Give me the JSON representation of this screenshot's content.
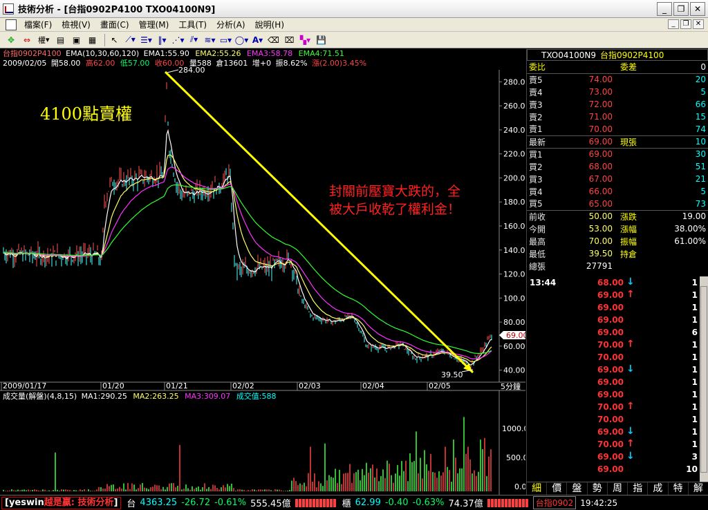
{
  "window": {
    "title": "技術分析 - [台指0902P4100 TXO04100N9]"
  },
  "menu": [
    "檔案(F)",
    "檢視(V)",
    "畫面(C)",
    "管理(M)",
    "工具(T)",
    "分析(A)",
    "說明(H)"
  ],
  "toolbar": {
    "period_label": "權"
  },
  "chart": {
    "info1": {
      "symbol": "台指0902P4100",
      "ema_head": "EMA(10,30,60,120)",
      "ema1": "EMA1:55.90",
      "ema2": "EMA2:55.26",
      "ema3": "EMA3:58.78",
      "ema4": "EMA4:71.51"
    },
    "info2": {
      "date": "2009/02/05",
      "open": "開58.00",
      "high": "高62.00",
      "low": "低57.00",
      "close": "收60.00",
      "vol": "量588",
      "oi": "倉13601",
      "oichg": "增+0",
      "amp": "振8.62%",
      "chg": "漲(2.00)3.45%"
    },
    "headline": "4100點賣權",
    "annotation_line1": "封關前壓寶大跌的，全",
    "annotation_line2": "被大戶收乾了權利金！",
    "peak_label": "284.00",
    "low_label": "39.50",
    "last_price": "69.00",
    "period": "5分鐘",
    "dates": [
      "2009/01/17",
      "01/20",
      "01/21",
      "02/02",
      "02/03",
      "02/04",
      "02/05"
    ],
    "vol_info": {
      "name": "成交量(解盤)(4,8,15)",
      "ma1": "MA1:290.25",
      "ma2": "MA2:263.25",
      "ma3": "MA3:309.07",
      "cur": "成交值:588"
    },
    "vol_ticks": [
      "1000.0",
      "500.0",
      "0.0"
    ]
  },
  "chart_data": {
    "type": "line",
    "title": "台指0902P4100",
    "y_ticks": [
      280,
      260,
      240,
      220,
      200,
      180,
      160,
      140,
      120,
      100,
      80,
      60,
      40
    ],
    "ylim": [
      30,
      290
    ],
    "price": {
      "high": 284.0,
      "low": 39.5,
      "last": 69.0
    },
    "series": [
      {
        "name": "EMA1:55.90",
        "color": "#ffffff"
      },
      {
        "name": "EMA2:55.26",
        "color": "#ffff66"
      },
      {
        "name": "EMA3:58.78",
        "color": "#ff33ff"
      },
      {
        "name": "EMA4:71.51",
        "color": "#33ff33"
      }
    ],
    "volume": {
      "ylim": [
        0,
        1400
      ],
      "ticks": [
        1000,
        500,
        0
      ]
    }
  },
  "quote": {
    "symbol1": "TXO04100N9",
    "symbol2": "台指0902P4100",
    "header": {
      "l1": "委比",
      "l2": "委差",
      "v2": "0"
    },
    "sell": [
      {
        "label": "賣5",
        "price": "74.00",
        "qty": "20"
      },
      {
        "label": "賣4",
        "price": "73.00",
        "qty": "5"
      },
      {
        "label": "賣3",
        "price": "72.00",
        "qty": "66"
      },
      {
        "label": "賣2",
        "price": "71.00",
        "qty": "15"
      },
      {
        "label": "賣1",
        "price": "70.00",
        "qty": "74"
      }
    ],
    "last": {
      "label": "最新",
      "price": "69.00",
      "label2": "現張",
      "qty": "10"
    },
    "buy": [
      {
        "label": "買1",
        "price": "69.00",
        "qty": "30"
      },
      {
        "label": "買2",
        "price": "68.00",
        "qty": "51"
      },
      {
        "label": "買3",
        "price": "67.00",
        "qty": "21"
      },
      {
        "label": "買4",
        "price": "66.00",
        "qty": "5"
      },
      {
        "label": "買5",
        "price": "65.00",
        "qty": "73"
      }
    ],
    "stats": [
      {
        "l1": "前收",
        "v1": "50.00",
        "l2": "漲跌",
        "v2": "19.00"
      },
      {
        "l1": "今開",
        "v1": "53.00",
        "l2": "漲幅",
        "v2": "38.00%"
      },
      {
        "l1": "最高",
        "v1": "70.00",
        "l2": "振幅",
        "v2": "61.00%"
      },
      {
        "l1": "最低",
        "v1": "39.50",
        "l2": "持倉",
        "v2": ""
      },
      {
        "l1": "總張",
        "v1": "27791",
        "l2": "",
        "v2": ""
      }
    ]
  },
  "ticks": [
    {
      "time": "13:44",
      "price": "68.00",
      "dir": "down",
      "qty": "1"
    },
    {
      "time": "",
      "price": "69.00",
      "dir": "up",
      "qty": "1"
    },
    {
      "time": "",
      "price": "69.00",
      "dir": "",
      "qty": "1"
    },
    {
      "time": "",
      "price": "69.00",
      "dir": "",
      "qty": "1"
    },
    {
      "time": "",
      "price": "69.00",
      "dir": "",
      "qty": "6"
    },
    {
      "time": "",
      "price": "70.00",
      "dir": "up",
      "qty": "1"
    },
    {
      "time": "",
      "price": "70.00",
      "dir": "",
      "qty": "1"
    },
    {
      "time": "",
      "price": "69.00",
      "dir": "down",
      "qty": "1"
    },
    {
      "time": "",
      "price": "69.00",
      "dir": "",
      "qty": "1"
    },
    {
      "time": "",
      "price": "69.00",
      "dir": "",
      "qty": "1"
    },
    {
      "time": "",
      "price": "70.00",
      "dir": "up",
      "qty": "1"
    },
    {
      "time": "",
      "price": "70.00",
      "dir": "",
      "qty": "1"
    },
    {
      "time": "",
      "price": "69.00",
      "dir": "down",
      "qty": "1"
    },
    {
      "time": "",
      "price": "70.00",
      "dir": "up",
      "qty": "1"
    },
    {
      "time": "",
      "price": "69.00",
      "dir": "down",
      "qty": "3"
    },
    {
      "time": "",
      "price": "69.00",
      "dir": "",
      "qty": "10"
    }
  ],
  "bottom_tabs": [
    "細",
    "價",
    "盤",
    "勢",
    "周",
    "指",
    "成",
    "特",
    "解"
  ],
  "status": {
    "brand1": "yeswin",
    "brand2": "越是贏:",
    "brand3": "技術分析",
    "idx_label": "台",
    "idx_value": "4363.25",
    "idx_change": "-26.72",
    "idx_pct": "-0.61%",
    "idx_amount": "555.45億",
    "otc_label": "櫃",
    "otc_value": "62.99",
    "otc_change": "-0.40",
    "otc_pct": "-0.63%",
    "otc_amount": "74.37億",
    "symbol": "台指0902",
    "time": "19:42:25"
  }
}
